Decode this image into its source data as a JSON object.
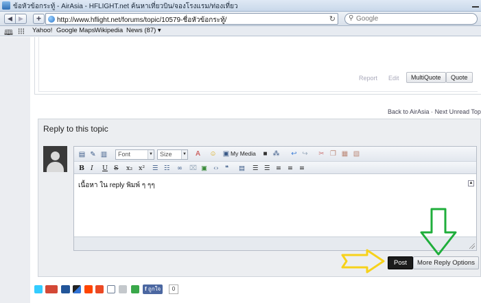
{
  "browser": {
    "window_title": "ข้อหัวข้อกระทู้ - AirAsia - HFLIGHT.net ค้นหาเที่ยวบิน/จองโรงแรม/ท่องเที่ยว",
    "url": "http://www.hflight.net/forums/topic/10579-ชื่อหัวข้อกระทู้/",
    "search_placeholder": "Google",
    "bookmarks": [
      "Yahoo!",
      "Google Maps",
      "Wikipedia",
      "News (87) ▾"
    ]
  },
  "post_actions": {
    "report": "Report",
    "edit": "Edit",
    "multiquote": "MultiQuote",
    "quote": "Quote"
  },
  "topic_links": {
    "back": "Back to AirAsia",
    "separator": "·",
    "next_unread": "Next Unread Topic →"
  },
  "reply": {
    "title": "Reply to this topic",
    "font_label": "Font",
    "size_label": "Size",
    "my_media": "My Media",
    "content": "เนื้อหา ใน reply พิมพ์ ๆ ๆๆ",
    "post_button": "Post",
    "more_options_button": "More Reply Options"
  },
  "share": {
    "fb_like": "ถูกใจ",
    "fb_count": "0"
  },
  "colors": {
    "post_button_bg": "#1b1b1b",
    "annotation_yellow": "#f7d21b",
    "annotation_green": "#1fae3b"
  }
}
